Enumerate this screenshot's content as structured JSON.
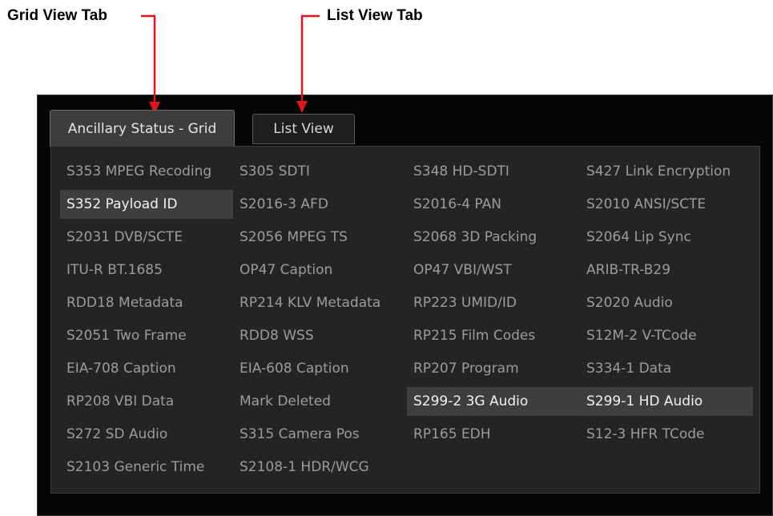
{
  "annotations": {
    "grid_view_label": "Grid View Tab",
    "list_view_label": "List View Tab",
    "arrow_color": "#e0161b"
  },
  "tabs": [
    {
      "label": "Ancillary Status - Grid",
      "selected": true
    },
    {
      "label": "List View",
      "selected": false
    }
  ],
  "grid": {
    "rows": [
      [
        {
          "label": "S353 MPEG Recoding",
          "active": false
        },
        {
          "label": "S305 SDTI",
          "active": false
        },
        {
          "label": "S348 HD-SDTI",
          "active": false
        },
        {
          "label": "S427 Link Encryption",
          "active": false
        }
      ],
      [
        {
          "label": "S352 Payload ID",
          "active": true
        },
        {
          "label": "S2016-3 AFD",
          "active": false
        },
        {
          "label": "S2016-4 PAN",
          "active": false
        },
        {
          "label": "S2010 ANSI/SCTE",
          "active": false
        }
      ],
      [
        {
          "label": "S2031 DVB/SCTE",
          "active": false
        },
        {
          "label": "S2056 MPEG TS",
          "active": false
        },
        {
          "label": "S2068 3D Packing",
          "active": false
        },
        {
          "label": "S2064 Lip Sync",
          "active": false
        }
      ],
      [
        {
          "label": "ITU-R BT.1685",
          "active": false
        },
        {
          "label": "OP47 Caption",
          "active": false
        },
        {
          "label": "OP47 VBI/WST",
          "active": false
        },
        {
          "label": "ARIB-TR-B29",
          "active": false
        }
      ],
      [
        {
          "label": "RDD18 Metadata",
          "active": false
        },
        {
          "label": "RP214 KLV Metadata",
          "active": false
        },
        {
          "label": "RP223 UMID/ID",
          "active": false
        },
        {
          "label": "S2020 Audio",
          "active": false
        }
      ],
      [
        {
          "label": "S2051 Two Frame",
          "active": false
        },
        {
          "label": "RDD8 WSS",
          "active": false
        },
        {
          "label": "RP215 Film Codes",
          "active": false
        },
        {
          "label": "S12M-2 V-TCode",
          "active": false
        }
      ],
      [
        {
          "label": "EIA-708 Caption",
          "active": false
        },
        {
          "label": "EIA-608 Caption",
          "active": false
        },
        {
          "label": "RP207 Program",
          "active": false
        },
        {
          "label": "S334-1 Data",
          "active": false
        }
      ],
      [
        {
          "label": "RP208 VBI Data",
          "active": false
        },
        {
          "label": "Mark Deleted",
          "active": false
        },
        {
          "label": "S299-2 3G Audio",
          "active": true
        },
        {
          "label": "S299-1 HD Audio",
          "active": true
        }
      ],
      [
        {
          "label": "S272 SD Audio",
          "active": false
        },
        {
          "label": "S315 Camera Pos",
          "active": false
        },
        {
          "label": "RP165 EDH",
          "active": false
        },
        {
          "label": "S12-3 HFR TCode",
          "active": false
        }
      ],
      [
        {
          "label": "S2103 Generic Time",
          "active": false
        },
        {
          "label": "S2108-1 HDR/WCG",
          "active": false
        },
        {
          "label": "",
          "active": false
        },
        {
          "label": "",
          "active": false
        }
      ]
    ]
  }
}
